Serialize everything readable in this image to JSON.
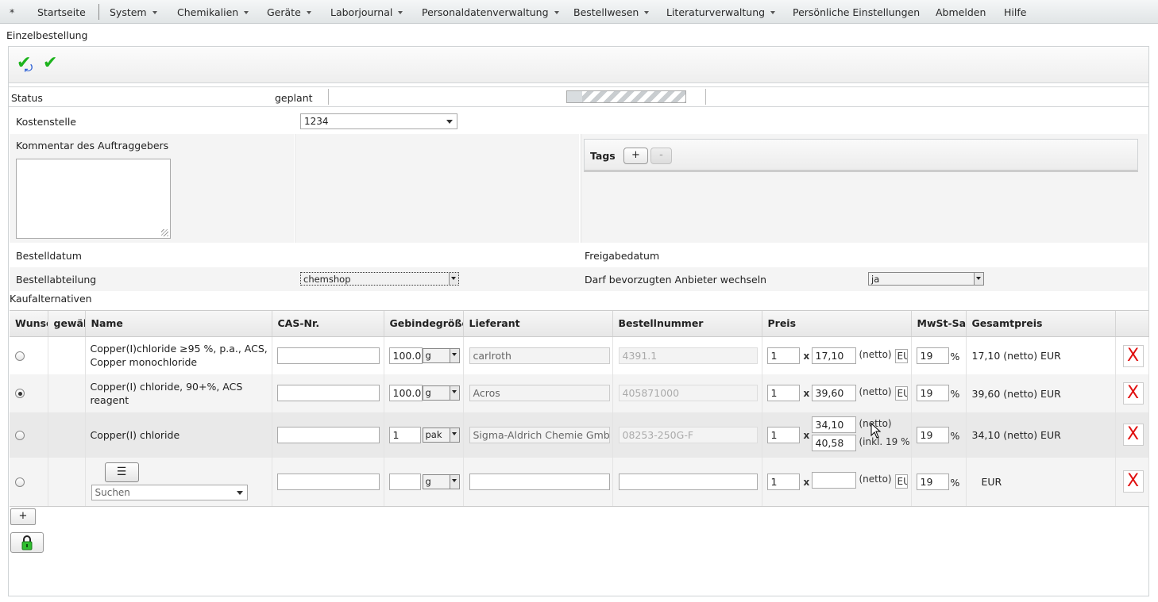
{
  "menu": {
    "star": "*",
    "items": [
      {
        "label": "Startseite",
        "dropdown": false
      },
      {
        "label": "System",
        "dropdown": true
      },
      {
        "label": "Chemikalien",
        "dropdown": true
      },
      {
        "label": "Geräte",
        "dropdown": true
      },
      {
        "label": "Laborjournal",
        "dropdown": true
      },
      {
        "label": "Personaldatenverwaltung",
        "dropdown": true
      },
      {
        "label": "Bestellwesen",
        "dropdown": true
      },
      {
        "label": "Literaturverwaltung",
        "dropdown": true
      },
      {
        "label": "Persönliche Einstellungen",
        "dropdown": false
      },
      {
        "label": "Abmelden",
        "dropdown": false
      },
      {
        "label": "Hilfe",
        "dropdown": false
      }
    ]
  },
  "page_title": "Einzelbestellung",
  "toolbar": {
    "icons": [
      "save-and-continue-icon",
      "save-checkmark-icon"
    ]
  },
  "status": {
    "label": "Status",
    "value": "geplant",
    "progress_fraction": 0.13
  },
  "form": {
    "kostenstelle_label": "Kostenstelle",
    "kostenstelle_value": "1234",
    "kommentar_label": "Kommentar des Auftraggebers",
    "tags_label": "Tags",
    "tag_add": "+",
    "tag_remove": "-",
    "bestelldatum_label": "Bestelldatum",
    "freigabedatum_label": "Freigabedatum",
    "bestellabteilung_label": "Bestellabteilung",
    "bestellabteilung_value": "chemshop",
    "anbieter_label": "Darf bevorzugten Anbieter wechseln",
    "anbieter_value": "ja"
  },
  "alternatives": {
    "section_label": "Kaufalternativen",
    "columns": [
      "Wunsch",
      "gewählt",
      "Name",
      "CAS-Nr.",
      "Gebindegröße",
      "Lieferant",
      "Bestellnummer",
      "Preis",
      "MwSt-Satz",
      "Gesamtpreis"
    ],
    "rows": [
      {
        "selected": false,
        "name": "Copper(I)chloride ≥95 %, p.a., ACS, Copper monochloride",
        "cas": "",
        "amount": "100.0",
        "unit": "g",
        "supplier": "carlroth",
        "order_no": "4391.1",
        "qty": "1",
        "price": "17,10",
        "price_note": "(netto)",
        "currency": "EU",
        "vat": "19",
        "total": "17,10 (netto) EUR"
      },
      {
        "selected": true,
        "name": "Copper(I) chloride, 90+%, ACS reagent",
        "cas": "",
        "amount": "100.0",
        "unit": "g",
        "supplier": "Acros",
        "order_no": "405871000",
        "qty": "1",
        "price": "39,60",
        "price_note": "(netto)",
        "currency": "EU",
        "vat": "19",
        "total": "39,60 (netto) EUR"
      },
      {
        "selected": false,
        "name": "Copper(I) chloride",
        "cas": "",
        "amount": "1",
        "unit": "pak",
        "supplier": "Sigma-Aldrich Chemie GmbH",
        "order_no": "08253-250G-F",
        "qty": "1",
        "price": "34,10",
        "price_note": "(netto)",
        "price2": "40,58",
        "price2_note": "(inkl. 19 %",
        "vat": "19",
        "total": "34,10 (netto) EUR"
      },
      {
        "selected": false,
        "name_search_placeholder": "Suchen",
        "cas": "",
        "amount": "",
        "unit": "g",
        "supplier": "",
        "order_no": "",
        "qty": "1",
        "price": "",
        "price_note": "(netto)",
        "currency": "EU",
        "vat": "19",
        "total": "EUR"
      }
    ],
    "percent": "%",
    "times": "x",
    "delete": "X",
    "add_row": "+"
  }
}
